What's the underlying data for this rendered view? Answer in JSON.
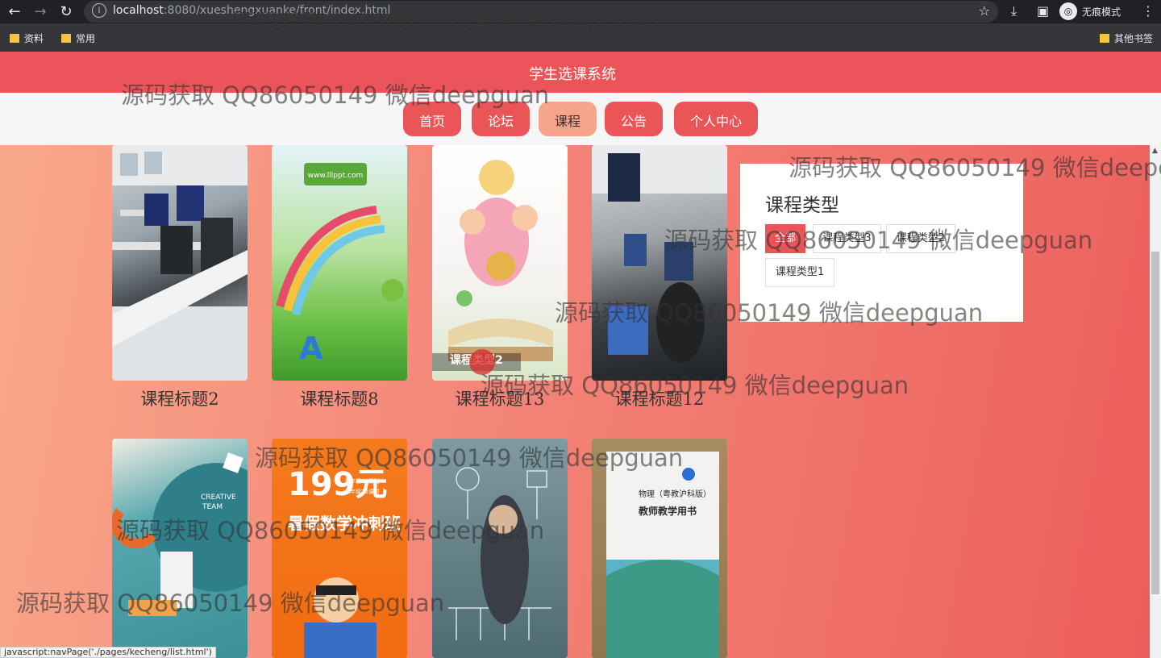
{
  "browser": {
    "url_host": "localhost",
    "url_rest": ":8080/xueshengxuanke/front/index.html",
    "incognito_label": "无痕模式",
    "bookmarks": [
      "资料",
      "常用"
    ],
    "other_bookmarks": "其他书签"
  },
  "site": {
    "title": "学生选课系统",
    "nav": [
      {
        "label": "首页"
      },
      {
        "label": "论坛"
      },
      {
        "label": "课程"
      },
      {
        "label": "公告"
      },
      {
        "label": "个人中心"
      }
    ]
  },
  "courses": [
    {
      "title": "课程标题2"
    },
    {
      "title": "课程标题8"
    },
    {
      "title": "课程标题13",
      "caption": "课程类型2"
    },
    {
      "title": "课程标题12"
    }
  ],
  "filter": {
    "heading": "课程类型",
    "options": [
      "全部",
      "课程类型3",
      "课程类型2",
      "课程类型1"
    ]
  },
  "image_texts": {
    "img8": "www.lllppt.com",
    "img15a": "199元",
    "img15b": "暑假数学冲刺班",
    "img15c": "三年级23课时\n六年级23课时",
    "img16": "物理（粤教沪科版）\n教师教学用书",
    "img13": "CREATIVE\nTEAM"
  },
  "status_tip": "javascript:navPage('./pages/kecheng/list.html')",
  "watermark": "源码获取 QQ86050149 微信deepguan"
}
